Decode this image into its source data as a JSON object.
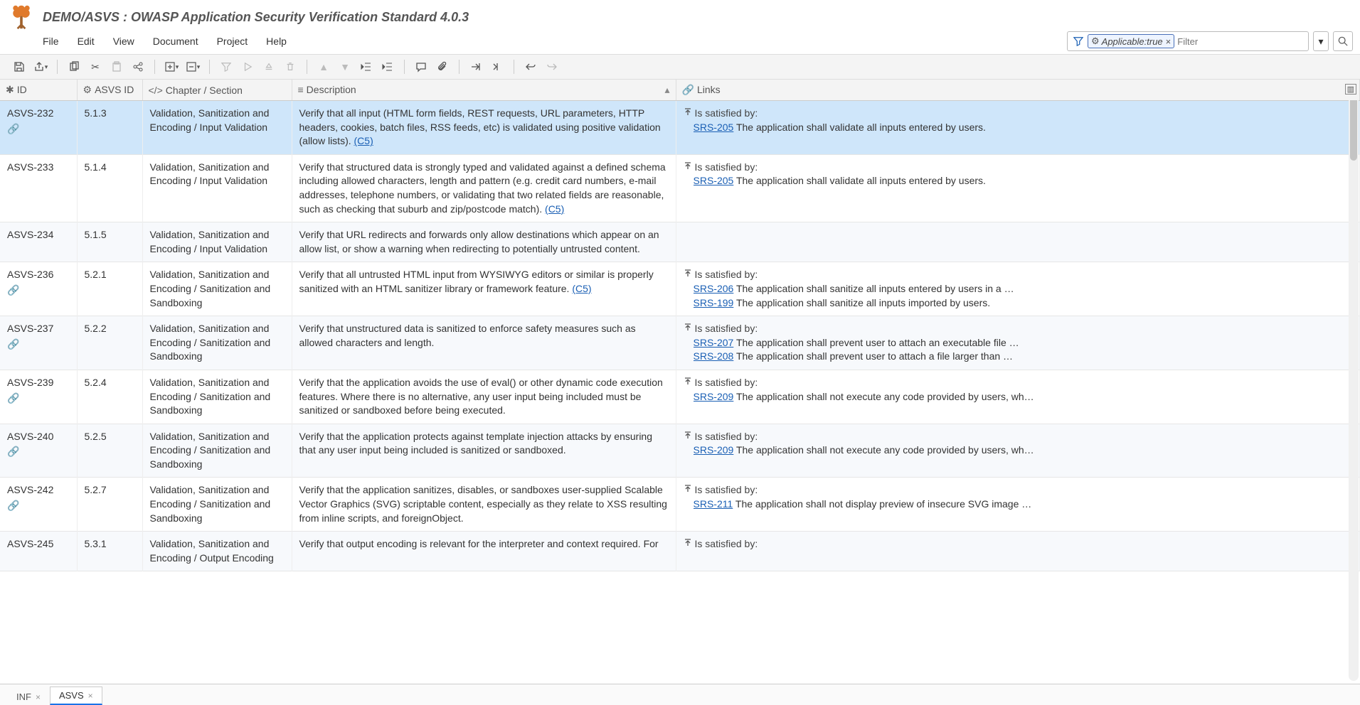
{
  "header": {
    "title": "DEMO/ASVS : OWASP Application Security Verification Standard 4.0.3"
  },
  "menu": [
    "File",
    "Edit",
    "View",
    "Document",
    "Project",
    "Help"
  ],
  "filter": {
    "chip_prefix": "Applicable: ",
    "chip_value": "true",
    "placeholder": "Filter"
  },
  "columns": {
    "id": "ID",
    "asvs": "ASVS ID",
    "chapter": "Chapter / Section",
    "description": "Description",
    "links": "Links"
  },
  "satisfied_label": "Is satisfied by:",
  "rows": [
    {
      "id": "ASVS-232",
      "has_link_icon": true,
      "asvs": "5.1.3",
      "chapter": "Validation, Sanitization and Encoding / Input Validation",
      "desc": "Verify that all input (HTML form fields, REST requests, URL parameters, HTTP headers, cookies, batch files, RSS feeds, etc) is validated using positive validation (allow lists). ",
      "desc_link": "(C5)",
      "links": [
        {
          "srs": "SRS-205",
          "txt": " The application shall validate all inputs entered by users."
        }
      ],
      "selected": true
    },
    {
      "id": "ASVS-233",
      "has_link_icon": false,
      "asvs": "5.1.4",
      "chapter": "Validation, Sanitization and Encoding / Input Validation",
      "desc": "Verify that structured data is strongly typed and validated against a defined schema including allowed characters, length and pattern (e.g. credit card numbers, e-mail addresses, telephone numbers, or validating that two related fields are reasonable, such as checking that suburb and zip/postcode match). ",
      "desc_link": "(C5)",
      "links": [
        {
          "srs": "SRS-205",
          "txt": " The application shall validate all inputs entered by users."
        }
      ]
    },
    {
      "id": "ASVS-234",
      "has_link_icon": false,
      "asvs": "5.1.5",
      "chapter": "Validation, Sanitization and Encoding / Input Validation",
      "desc": "Verify that URL redirects and forwards only allow destinations which appear on an allow list, or show a warning when redirecting to potentially untrusted content.",
      "links": []
    },
    {
      "id": "ASVS-236",
      "has_link_icon": true,
      "asvs": "5.2.1",
      "chapter": "Validation, Sanitization and Encoding / Sanitization and Sandboxing",
      "desc": "Verify that all untrusted HTML input from WYSIWYG editors or similar is properly sanitized with an HTML sanitizer library or framework feature. ",
      "desc_link": "(C5)",
      "links": [
        {
          "srs": "SRS-206",
          "txt": " The application shall sanitize all inputs entered by users in a …"
        },
        {
          "srs": "SRS-199",
          "txt": " The application shall sanitize all inputs imported by users."
        }
      ]
    },
    {
      "id": "ASVS-237",
      "has_link_icon": true,
      "asvs": "5.2.2",
      "chapter": "Validation, Sanitization and Encoding / Sanitization and Sandboxing",
      "desc": "Verify that unstructured data is sanitized to enforce safety measures such as allowed characters and length.",
      "links": [
        {
          "srs": "SRS-207",
          "txt": " The application shall prevent user to attach an executable file …"
        },
        {
          "srs": "SRS-208",
          "txt": " The application shall prevent user to attach a file larger than …"
        }
      ]
    },
    {
      "id": "ASVS-239",
      "has_link_icon": true,
      "asvs": "5.2.4",
      "chapter": "Validation, Sanitization and Encoding / Sanitization and Sandboxing",
      "desc": "Verify that the application avoids the use of eval() or other dynamic code execution features. Where there is no alternative, any user input being included must be sanitized or sandboxed before being executed.",
      "links": [
        {
          "srs": "SRS-209",
          "txt": " The application shall not execute any code provided by users, wh…"
        }
      ]
    },
    {
      "id": "ASVS-240",
      "has_link_icon": true,
      "asvs": "5.2.5",
      "chapter": "Validation, Sanitization and Encoding / Sanitization and Sandboxing",
      "desc": "Verify that the application protects against template injection attacks by ensuring that any user input being included is sanitized or sandboxed.",
      "links": [
        {
          "srs": "SRS-209",
          "txt": " The application shall not execute any code provided by users, wh…"
        }
      ]
    },
    {
      "id": "ASVS-242",
      "has_link_icon": true,
      "asvs": "5.2.7",
      "chapter": "Validation, Sanitization and Encoding / Sanitization and Sandboxing",
      "desc": "Verify that the application sanitizes, disables, or sandboxes user-supplied Scalable Vector Graphics (SVG) scriptable content, especially as they relate to XSS resulting from inline scripts, and foreignObject.",
      "links": [
        {
          "srs": "SRS-211",
          "txt": " The application shall not display preview of insecure SVG image …"
        }
      ]
    },
    {
      "id": "ASVS-245",
      "has_link_icon": false,
      "asvs": "5.3.1",
      "chapter": "Validation, Sanitization and Encoding / Output Encoding",
      "desc": "Verify that output encoding is relevant for the interpreter and context required. For",
      "links_label_only": true,
      "links": []
    }
  ],
  "tabs": [
    {
      "label": "INF",
      "active": false
    },
    {
      "label": "ASVS",
      "active": true
    }
  ]
}
